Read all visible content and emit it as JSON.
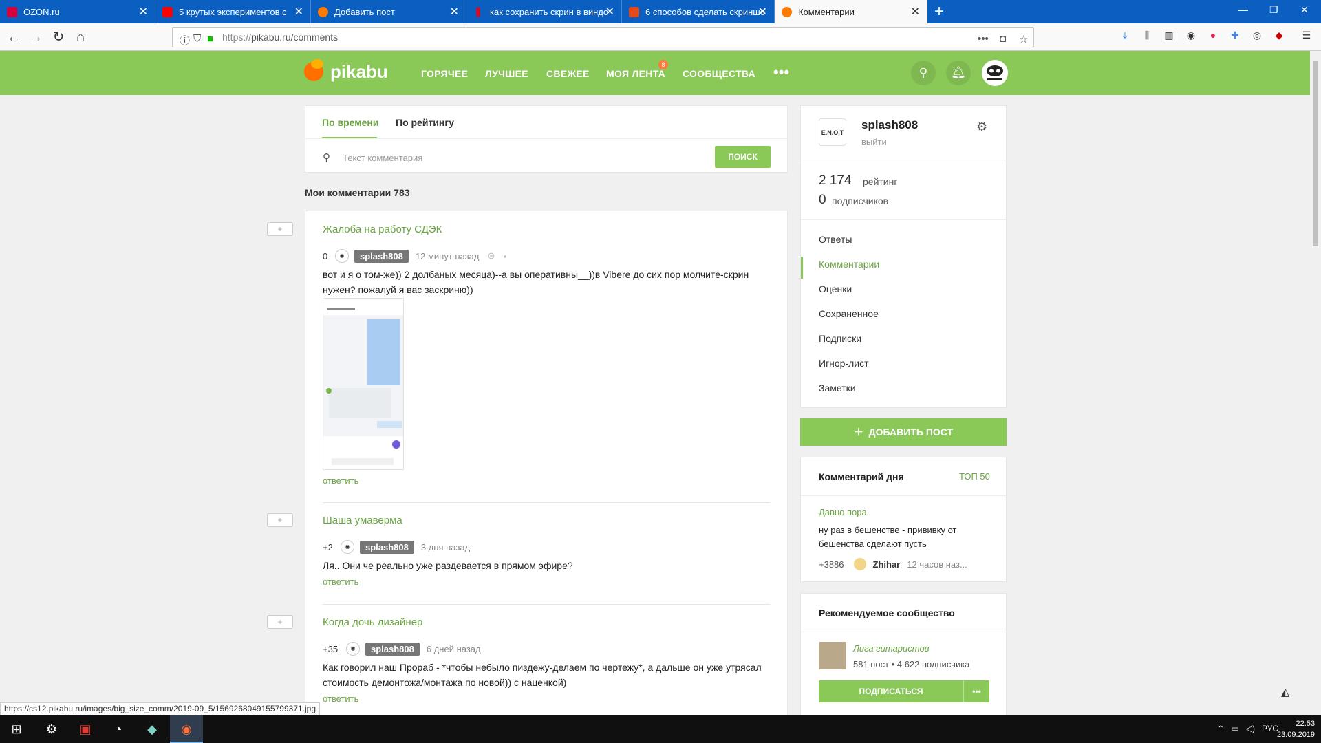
{
  "browser": {
    "tabs": [
      {
        "title": "OZON.ru",
        "color": "#d6003c"
      },
      {
        "title": "5 крутых экспериментов с",
        "color": "#ff0000"
      },
      {
        "title": "Добавить пост",
        "color": "#ff7a00"
      },
      {
        "title": "как сохранить скрин в виндо",
        "color": "#c8102e"
      },
      {
        "title": "6 способов сделать скриншо",
        "color": "#e64a19"
      },
      {
        "title": "Комментарии",
        "color": "#ff7a00"
      }
    ],
    "url_scheme": "https://",
    "url": "pikabu.ru/comments",
    "status_url": "https://cs12.pikabu.ru/images/big_size_comm/2019-09_5/1569268049155799371.jpg"
  },
  "pikabu": {
    "logo": "pikabu",
    "nav": [
      "ГОРЯЧЕЕ",
      "ЛУЧШЕЕ",
      "СВЕЖЕЕ",
      "МОЯ ЛЕНТА",
      "СООБЩЕСТВА"
    ],
    "feed_badge": "8",
    "more": "•••"
  },
  "sort": {
    "tab_time": "По времени",
    "tab_rating": "По рейтингу",
    "search_placeholder": "Текст комментария",
    "search_button": "ПОИСК"
  },
  "my_comments": "Мои комментарии 783",
  "comments": [
    {
      "post": "Жалоба на работу СДЭК",
      "rating": "0",
      "user": "splash808",
      "time": "12 минут назад",
      "text": "вот и я о том-же)) 2 долбаных месяца)--а вы оперативны__))в Vibere  до сих пор молчите-скрин нужен? пожалуй я вас заскриню))",
      "reply": "ответить"
    },
    {
      "post": "Шаша умаверма",
      "rating": "+2",
      "user": "splash808",
      "time": "3 дня назад",
      "text": "Ля.. Они че реально уже раздевается в прямом эфире?",
      "reply": "ответить"
    },
    {
      "post": "Когда дочь дизайнер",
      "rating": "+35",
      "user": "splash808",
      "time": "6 дней назад",
      "text": "Как говорил наш Прораб - *чтобы небыло пиздежу-делаем по чертежу*, а дальше он уже утрясал стоимость демонтожа/монтажа по новой)) с наценкой)",
      "reply": "ответить"
    }
  ],
  "profile": {
    "avatar_text": "E.N.O.T",
    "name": "splash808",
    "logout": "выйти",
    "rating_value": "2 174",
    "rating_label": "рейтинг",
    "subscribers_value": "0",
    "subscribers_label": "подписчиков",
    "menu": [
      "Ответы",
      "Комментарии",
      "Оценки",
      "Сохраненное",
      "Подписки",
      "Игнор-лист",
      "Заметки"
    ]
  },
  "add_post": "ДОБАВИТЬ ПОСТ",
  "comment_of_day": {
    "title": "Комментарий дня",
    "top": "ТОП 50",
    "post": "Давно пора",
    "text": "ну раз в бешенстве - прививку от бешенства сделают пусть",
    "rating": "+3886",
    "user": "Zhihar",
    "time": "12 часов наз..."
  },
  "recommended": {
    "title": "Рекомендуемое сообщество",
    "name": "Лига гитаристов",
    "stats": "581 пост  •  4 622 подписчика",
    "subscribe": "ПОДПИСАТЬСЯ",
    "more": "•••"
  },
  "taskbar": {
    "lang": "РУС",
    "time": "22:53",
    "date": "23.09.2019"
  }
}
